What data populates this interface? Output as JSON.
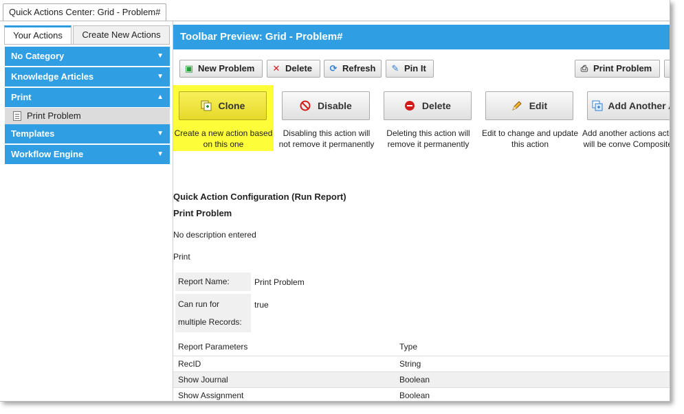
{
  "window": {
    "tab_title": "Quick Actions Center: Grid - Problem#"
  },
  "left": {
    "tabs": [
      "Your Actions",
      "Create New Actions"
    ],
    "categories": {
      "no_category": "No Category",
      "knowledge": "Knowledge Articles",
      "print": "Print",
      "print_item": "Print Problem",
      "templates": "Templates",
      "workflow": "Workflow Engine"
    },
    "arrow_down": "▼",
    "arrow_up": "▲"
  },
  "header": {
    "title": "Toolbar Preview: Grid - Problem#"
  },
  "toolbar": {
    "new_problem": "New Problem",
    "delete": "Delete",
    "refresh": "Refresh",
    "pin_it": "Pin It",
    "print_problem": "Print Problem"
  },
  "actions": {
    "clone": {
      "label": "Clone",
      "desc": "Create a new action based on this one"
    },
    "disable": {
      "label": "Disable",
      "desc": "Disabling this action will not remove it permanently"
    },
    "delete": {
      "label": "Delete",
      "desc": "Deleting this action will remove it permanently"
    },
    "edit": {
      "label": "Edit",
      "desc": "Edit to change and update this action"
    },
    "add_another": {
      "label": "Add Another A",
      "desc": "Add another actions action will be conve Composite if nee"
    }
  },
  "config": {
    "section_title": "Quick Action Configuration (Run Report)",
    "name": "Print Problem",
    "description": "No description entered",
    "category": "Print",
    "report_name_label": "Report Name:",
    "report_name_value": "Print Problem",
    "multi_label_1": "Can run for",
    "multi_label_2": "multiple Records:",
    "multi_value": "true"
  },
  "params_table": {
    "headers": [
      "Report Parameters",
      "Type"
    ],
    "rows": [
      [
        "RecID",
        "String"
      ],
      [
        "Show Journal",
        "Boolean"
      ],
      [
        "Show Assignment",
        "Boolean"
      ]
    ]
  },
  "colors": {
    "accent": "#2f9ee3",
    "highlight": "#fdfd3a"
  }
}
